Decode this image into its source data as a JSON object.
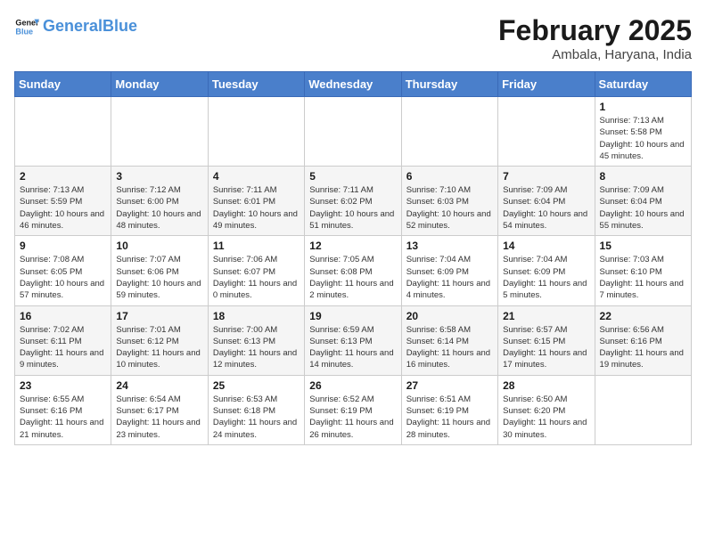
{
  "header": {
    "logo_general": "General",
    "logo_blue": "Blue",
    "month_year": "February 2025",
    "location": "Ambala, Haryana, India"
  },
  "weekdays": [
    "Sunday",
    "Monday",
    "Tuesday",
    "Wednesday",
    "Thursday",
    "Friday",
    "Saturday"
  ],
  "weeks": [
    [
      {
        "day": "",
        "info": ""
      },
      {
        "day": "",
        "info": ""
      },
      {
        "day": "",
        "info": ""
      },
      {
        "day": "",
        "info": ""
      },
      {
        "day": "",
        "info": ""
      },
      {
        "day": "",
        "info": ""
      },
      {
        "day": "1",
        "info": "Sunrise: 7:13 AM\nSunset: 5:58 PM\nDaylight: 10 hours and 45 minutes."
      }
    ],
    [
      {
        "day": "2",
        "info": "Sunrise: 7:13 AM\nSunset: 5:59 PM\nDaylight: 10 hours and 46 minutes."
      },
      {
        "day": "3",
        "info": "Sunrise: 7:12 AM\nSunset: 6:00 PM\nDaylight: 10 hours and 48 minutes."
      },
      {
        "day": "4",
        "info": "Sunrise: 7:11 AM\nSunset: 6:01 PM\nDaylight: 10 hours and 49 minutes."
      },
      {
        "day": "5",
        "info": "Sunrise: 7:11 AM\nSunset: 6:02 PM\nDaylight: 10 hours and 51 minutes."
      },
      {
        "day": "6",
        "info": "Sunrise: 7:10 AM\nSunset: 6:03 PM\nDaylight: 10 hours and 52 minutes."
      },
      {
        "day": "7",
        "info": "Sunrise: 7:09 AM\nSunset: 6:04 PM\nDaylight: 10 hours and 54 minutes."
      },
      {
        "day": "8",
        "info": "Sunrise: 7:09 AM\nSunset: 6:04 PM\nDaylight: 10 hours and 55 minutes."
      }
    ],
    [
      {
        "day": "9",
        "info": "Sunrise: 7:08 AM\nSunset: 6:05 PM\nDaylight: 10 hours and 57 minutes."
      },
      {
        "day": "10",
        "info": "Sunrise: 7:07 AM\nSunset: 6:06 PM\nDaylight: 10 hours and 59 minutes."
      },
      {
        "day": "11",
        "info": "Sunrise: 7:06 AM\nSunset: 6:07 PM\nDaylight: 11 hours and 0 minutes."
      },
      {
        "day": "12",
        "info": "Sunrise: 7:05 AM\nSunset: 6:08 PM\nDaylight: 11 hours and 2 minutes."
      },
      {
        "day": "13",
        "info": "Sunrise: 7:04 AM\nSunset: 6:09 PM\nDaylight: 11 hours and 4 minutes."
      },
      {
        "day": "14",
        "info": "Sunrise: 7:04 AM\nSunset: 6:09 PM\nDaylight: 11 hours and 5 minutes."
      },
      {
        "day": "15",
        "info": "Sunrise: 7:03 AM\nSunset: 6:10 PM\nDaylight: 11 hours and 7 minutes."
      }
    ],
    [
      {
        "day": "16",
        "info": "Sunrise: 7:02 AM\nSunset: 6:11 PM\nDaylight: 11 hours and 9 minutes."
      },
      {
        "day": "17",
        "info": "Sunrise: 7:01 AM\nSunset: 6:12 PM\nDaylight: 11 hours and 10 minutes."
      },
      {
        "day": "18",
        "info": "Sunrise: 7:00 AM\nSunset: 6:13 PM\nDaylight: 11 hours and 12 minutes."
      },
      {
        "day": "19",
        "info": "Sunrise: 6:59 AM\nSunset: 6:13 PM\nDaylight: 11 hours and 14 minutes."
      },
      {
        "day": "20",
        "info": "Sunrise: 6:58 AM\nSunset: 6:14 PM\nDaylight: 11 hours and 16 minutes."
      },
      {
        "day": "21",
        "info": "Sunrise: 6:57 AM\nSunset: 6:15 PM\nDaylight: 11 hours and 17 minutes."
      },
      {
        "day": "22",
        "info": "Sunrise: 6:56 AM\nSunset: 6:16 PM\nDaylight: 11 hours and 19 minutes."
      }
    ],
    [
      {
        "day": "23",
        "info": "Sunrise: 6:55 AM\nSunset: 6:16 PM\nDaylight: 11 hours and 21 minutes."
      },
      {
        "day": "24",
        "info": "Sunrise: 6:54 AM\nSunset: 6:17 PM\nDaylight: 11 hours and 23 minutes."
      },
      {
        "day": "25",
        "info": "Sunrise: 6:53 AM\nSunset: 6:18 PM\nDaylight: 11 hours and 24 minutes."
      },
      {
        "day": "26",
        "info": "Sunrise: 6:52 AM\nSunset: 6:19 PM\nDaylight: 11 hours and 26 minutes."
      },
      {
        "day": "27",
        "info": "Sunrise: 6:51 AM\nSunset: 6:19 PM\nDaylight: 11 hours and 28 minutes."
      },
      {
        "day": "28",
        "info": "Sunrise: 6:50 AM\nSunset: 6:20 PM\nDaylight: 11 hours and 30 minutes."
      },
      {
        "day": "",
        "info": ""
      }
    ]
  ]
}
